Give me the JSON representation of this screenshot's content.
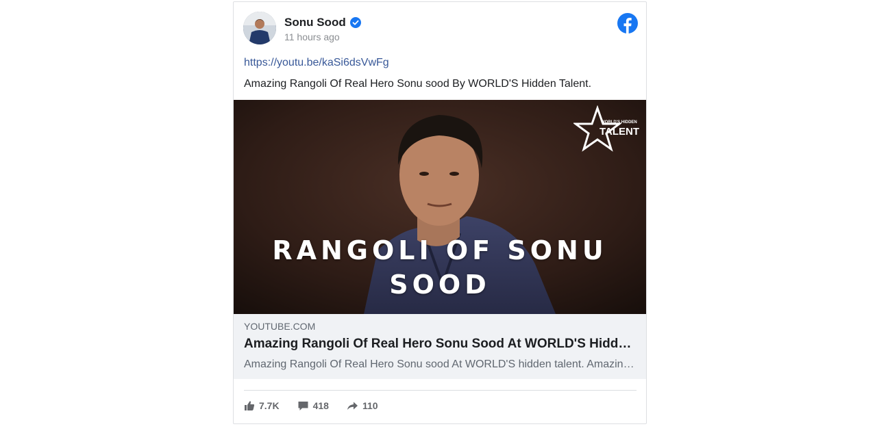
{
  "post": {
    "author": "Sonu Sood",
    "timestamp": "11 hours ago",
    "link_text": "https://youtu.be/kaSi6dsVwFg",
    "caption": "Amazing Rangoli Of Real Hero Sonu sood By WORLD'S Hidden Talent."
  },
  "preview": {
    "thumbnail_title_line1": "RANGOLI OF SONU",
    "thumbnail_title_line2": "SOOD",
    "logo_small": "WORLD'S HIDDEN",
    "logo_big": "TALENT",
    "domain": "YOUTUBE.COM",
    "title": "Amazing Rangoli Of Real Hero Sonu Sood At WORLD'S Hidden Talent",
    "description": "Amazing Rangoli Of Real Hero Sonu sood At WORLD'S hidden talent. Amazing Rangoli Of Real Hero Sonu sood"
  },
  "stats": {
    "likes": "7.7K",
    "comments": "418",
    "shares": "110"
  },
  "icons": {
    "verified": "verified-badge-icon",
    "facebook": "facebook-logo-icon",
    "like": "thumbs-up-icon",
    "comment": "comment-icon",
    "share": "share-arrow-icon"
  },
  "colors": {
    "facebook_blue": "#1877f2",
    "link": "#385898",
    "meta_bg": "#f0f2f5",
    "muted": "#65676b"
  }
}
